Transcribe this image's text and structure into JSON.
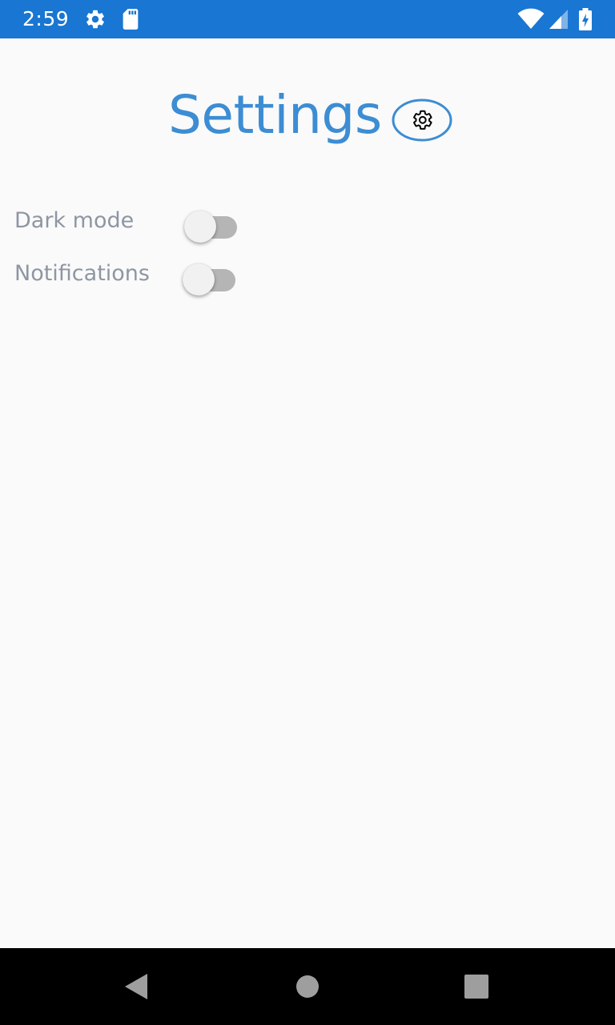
{
  "status_bar": {
    "time": "2:59",
    "background_color": "#1976D2",
    "icons": [
      "gear-icon",
      "sd-card-icon",
      "wifi-icon",
      "signal-icon",
      "battery-charging-icon"
    ]
  },
  "header": {
    "title": "Settings",
    "title_color": "#3C8DD3",
    "icon": "gear-icon"
  },
  "settings": [
    {
      "label": "Dark mode",
      "enabled": false
    },
    {
      "label": "Notifications",
      "enabled": false
    }
  ],
  "nav_bar": {
    "buttons": [
      "back-icon",
      "home-icon",
      "recents-icon"
    ]
  }
}
